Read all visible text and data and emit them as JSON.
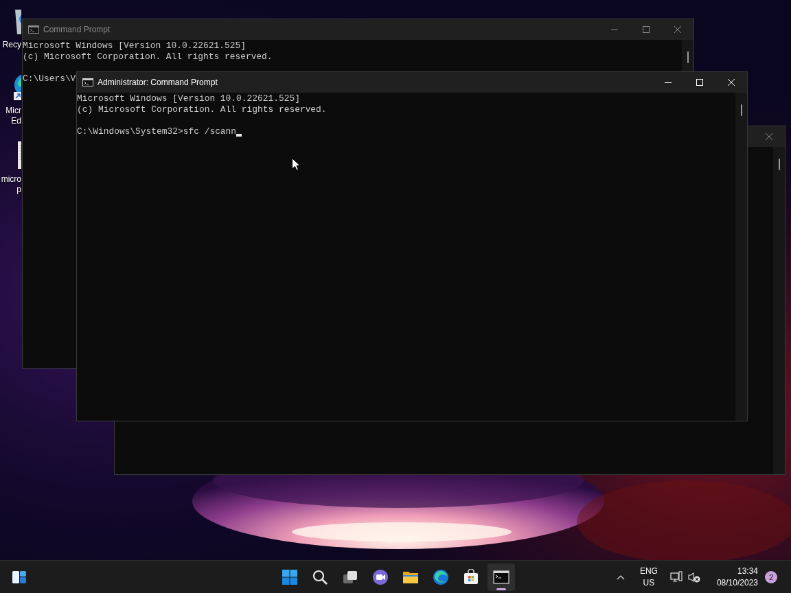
{
  "desktop_icons": [
    {
      "kind": "recycle-bin",
      "lines": [
        "Recy"
      ]
    },
    {
      "kind": "shortcut",
      "lines": [
        "Micr",
        "Ed"
      ]
    },
    {
      "kind": "document",
      "lines": [
        "micro",
        "p"
      ]
    }
  ],
  "windows": [
    {
      "title": "Command Prompt",
      "active": false,
      "controls": [
        {
          "kind": "minimize"
        },
        {
          "kind": "maximize"
        },
        {
          "kind": "close"
        }
      ],
      "lines": [
        {
          "kind": "text",
          "text": "Microsoft Windows [Version 10.0.22621.525]"
        },
        {
          "kind": "text",
          "text": "(c) Microsoft Corporation. All rights reserved."
        },
        {
          "kind": "blank"
        },
        {
          "kind": "text",
          "text": "C:\\Users\\V"
        }
      ]
    },
    {
      "active": false,
      "controls": [
        {
          "kind": "close"
        }
      ]
    },
    {
      "title": "Administrator: Command Prompt",
      "active": true,
      "controls": [
        {
          "kind": "minimize"
        },
        {
          "kind": "maximize"
        },
        {
          "kind": "close"
        }
      ],
      "cursor": true,
      "lines": [
        {
          "kind": "text",
          "text": "Microsoft Windows [Version 10.0.22621.525]"
        },
        {
          "kind": "text",
          "text": "(c) Microsoft Corporation. All rights reserved."
        },
        {
          "kind": "blank"
        },
        {
          "kind": "text",
          "text": "C:\\Windows\\System32>sfc /scann"
        }
      ]
    }
  ],
  "taskbar": {
    "apps": [
      {
        "kind": "widgets",
        "active": false
      },
      {
        "kind": "start",
        "active": false
      },
      {
        "kind": "search",
        "active": false
      },
      {
        "kind": "task-view",
        "active": false
      },
      {
        "kind": "chat",
        "active": false
      },
      {
        "kind": "file-explorer",
        "active": false
      },
      {
        "kind": "browser",
        "active": false
      },
      {
        "kind": "store",
        "active": false
      },
      {
        "kind": "terminal",
        "active": true
      }
    ],
    "language": [
      "ENG",
      "US"
    ],
    "clock": {
      "time": "13:34",
      "date": "08/10/2023"
    },
    "notification_count": "2"
  }
}
